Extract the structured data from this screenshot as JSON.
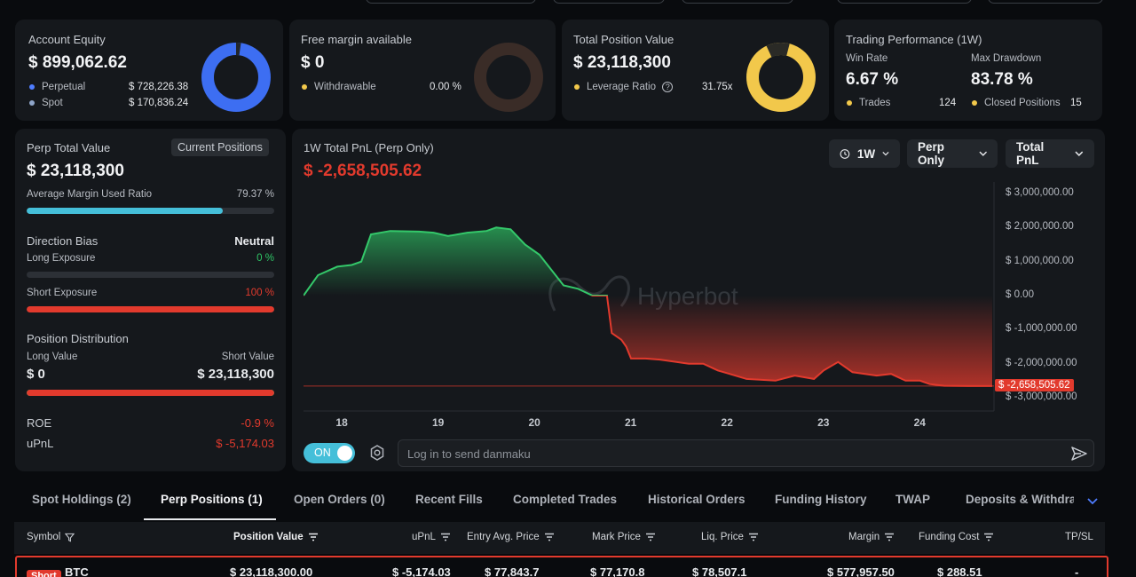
{
  "account_equity": {
    "title": "Account Equity",
    "value": "$ 899,062.62",
    "rows": [
      {
        "label": "Perpetual",
        "value": "$ 728,226.38"
      },
      {
        "label": "Spot",
        "value": "$ 170,836.24"
      }
    ],
    "donut": {
      "perpetual": 728226.38,
      "spot": 170836.24
    }
  },
  "free_margin": {
    "title": "Free margin available",
    "value": "$ 0",
    "row_label": "Withdrawable",
    "row_value": "0.00 %",
    "withdrawable_fraction": 0
  },
  "total_position": {
    "title": "Total Position Value",
    "value": "$ 23,118,300",
    "row_label": "Leverage Ratio",
    "row_value": "31.75x"
  },
  "trading_performance": {
    "title": "Trading Performance (1W)",
    "win_rate_label": "Win Rate",
    "win_rate": "6.67 %",
    "max_drawdown_label": "Max Drawdown",
    "max_drawdown": "83.78 %",
    "trades_label": "Trades",
    "trades": "124",
    "closed_label": "Closed Positions",
    "closed": "15"
  },
  "perp_panel": {
    "title": "Perp Total Value",
    "badge": "Current Positions",
    "value": "$ 23,118,300",
    "margin_label": "Average Margin Used Ratio",
    "margin_value": "79.37 %",
    "margin_fraction": 0.7937,
    "bias_label": "Direction Bias",
    "bias_value": "Neutral",
    "long_label": "Long Exposure",
    "long_value": "0 %",
    "long_fraction": 0,
    "short_label": "Short Exposure",
    "short_value": "100 %",
    "short_fraction": 1,
    "dist_label": "Position Distribution",
    "long_value_label": "Long Value",
    "long_value_amount": "$ 0",
    "short_value_label": "Short Value",
    "short_value_amount": "$ 23,118,300",
    "dist_short_fraction": 1,
    "roe_label": "ROE",
    "roe_value": "-0.9 %",
    "upnl_label": "uPnL",
    "upnl_value": "$ -5,174.03"
  },
  "pnl_panel": {
    "title": "1W Total PnL (Perp Only)",
    "value": "$ -2,658,505.62",
    "dropdowns": [
      "1W",
      "Perp Only",
      "Total PnL"
    ],
    "watermark": "Hyperbot",
    "toggle_label": "ON",
    "danmaku_placeholder": "Log in to send danmaku",
    "current_label": "$ -2,658,505.62"
  },
  "chart_data": {
    "type": "area",
    "x_ticks": [
      "18",
      "19",
      "20",
      "21",
      "22",
      "23",
      "24"
    ],
    "y_ticks": [
      "$ 3,000,000.00",
      "$ 2,000,000.00",
      "$ 1,000,000.00",
      "$ 0.00",
      "$ -1,000,000.00",
      "$ -2,000,000.00",
      "$ -3,000,000.00"
    ],
    "ylim": [
      -3000000,
      3000000
    ],
    "xlim": [
      17.6,
      24.75
    ],
    "x": [
      17.6,
      17.75,
      17.95,
      18.1,
      18.2,
      18.3,
      18.5,
      18.8,
      18.95,
      19.1,
      19.3,
      19.5,
      19.6,
      19.75,
      19.9,
      20.05,
      20.3,
      20.45,
      20.6,
      20.75,
      20.8,
      20.9,
      20.95,
      21.0,
      21.15,
      21.3,
      21.6,
      21.75,
      21.9,
      22.0,
      22.2,
      22.5,
      22.7,
      22.9,
      23.0,
      23.15,
      23.3,
      23.55,
      23.7,
      23.85,
      24.0,
      24.1,
      24.25,
      24.5,
      24.75
    ],
    "y": [
      0,
      600000,
      850000,
      900000,
      1000000,
      1800000,
      1900000,
      1880000,
      1850000,
      1750000,
      1850000,
      1900000,
      2000000,
      1950000,
      1500000,
      1200000,
      300000,
      200000,
      0,
      0,
      -1100000,
      -1300000,
      -1500000,
      -1850000,
      -1850000,
      -1880000,
      -2000000,
      -2000000,
      -2200000,
      -2280000,
      -2450000,
      -2500000,
      -2350000,
      -2450000,
      -2200000,
      -1950000,
      -2250000,
      -2350000,
      -2300000,
      -2500000,
      -2500000,
      -2600000,
      -2650000,
      -2658505.62,
      -2658505.62
    ]
  },
  "tabs": [
    "Spot Holdings (2)",
    "Perp Positions (1)",
    "Open Orders (0)",
    "Recent Fills",
    "Completed Trades",
    "Historical Orders",
    "Funding History",
    "TWAP",
    "Deposits & Withdraw"
  ],
  "table": {
    "columns": [
      "Symbol",
      "Position Value",
      "uPnL",
      "Entry Avg. Price",
      "Mark Price",
      "Liq. Price",
      "Margin",
      "Funding Cost",
      "TP/SL"
    ],
    "row": {
      "side": "Short",
      "symbol": "BTC",
      "position_value": "$ 23,118,300.00",
      "upnl": "$ -5,174.03",
      "entry": "$ 77,843.7",
      "mark": "$ 77,170.8",
      "liq": "$ 78,507.1",
      "margin": "$ 577,957.50",
      "funding": "$ 288.51",
      "tpsl": "-"
    }
  },
  "colors": {
    "accent_blue": "#3d6ef2",
    "accent_yellow": "#f2c84b",
    "accent_cyan": "#45bfd9",
    "positive": "#2fc566",
    "negative": "#e23a2d",
    "background": "#090b0e",
    "card": "#15181c"
  }
}
